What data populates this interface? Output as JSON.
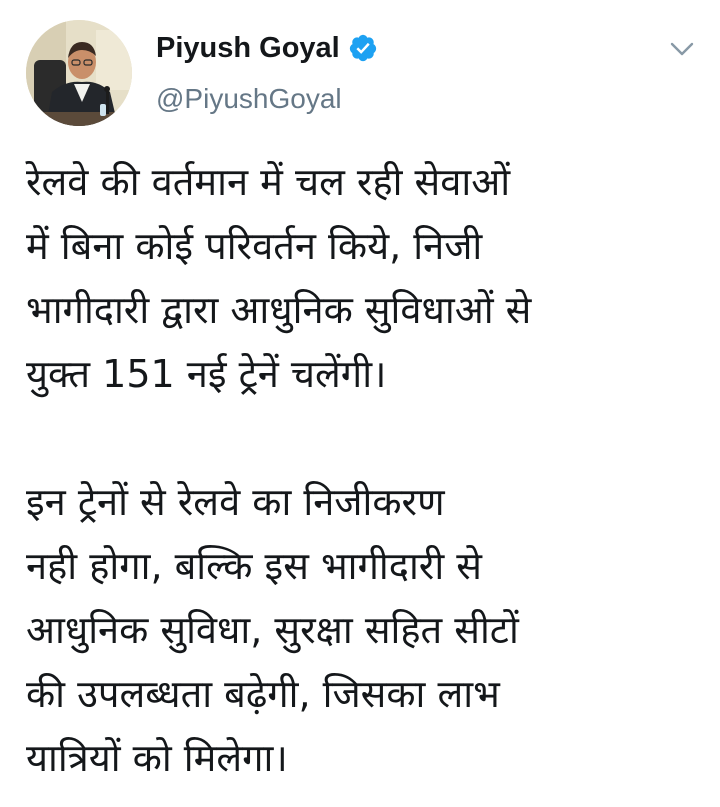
{
  "author": {
    "display_name": "Piyush Goyal",
    "handle": "@PiyushGoyal",
    "verified_icon": "verified-badge-icon",
    "avatar": "avatar-photo"
  },
  "menu": {
    "icon": "chevron-down-icon"
  },
  "tweet": {
    "paragraphs": [
      {
        "lines": [
          "रेलवे की वर्तमान में चल रही सेवाओं",
          "में बिना कोई परिवर्तन किये, निजी",
          "भागीदारी द्वारा आधुनिक सुविधाओं से",
          "युक्त 151 नई ट्रेनें चलेंगी।"
        ]
      },
      {
        "lines": [
          "इन ट्रेनों से रेलवे का निजीकरण",
          "नही होगा, बल्कि इस भागीदारी से",
          "आधुनिक सुविधा, सुरक्षा सहित सीटों",
          "की उपलब्धता बढ़ेगी, जिसका लाभ",
          "यात्रियों को मिलेगा।"
        ]
      }
    ]
  },
  "colors": {
    "text": "#14171a",
    "secondary": "#657786",
    "verified": "#1da1f2",
    "background": "#ffffff"
  }
}
